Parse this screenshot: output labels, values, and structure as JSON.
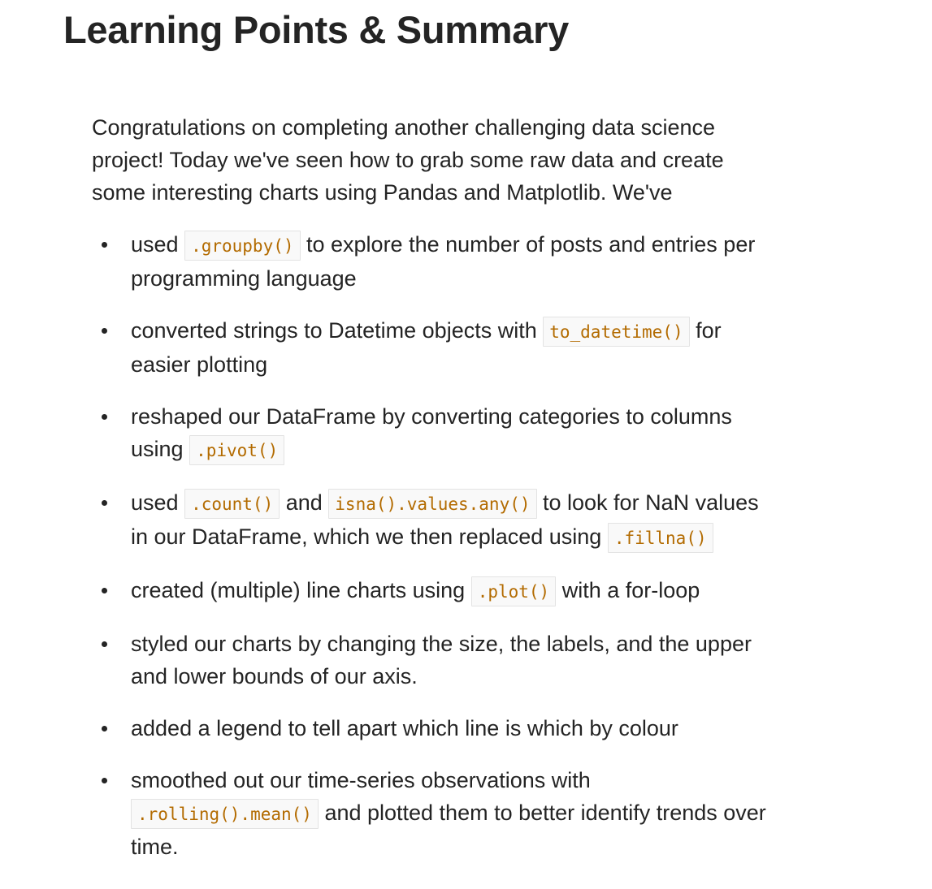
{
  "heading": "Learning Points & Summary",
  "intro": "Congratulations on completing another challenging data science project! Today we've seen how to grab some raw data and create some interesting charts using Pandas and Matplotlib. We've",
  "points": [
    {
      "t1": "used ",
      "c1": ".groupby()",
      "t2": " to explore the number of posts and entries per programming language"
    },
    {
      "t1": "converted strings to Datetime objects with ",
      "c1": "to_datetime()",
      "t2": " for easier plotting"
    },
    {
      "t1": "reshaped our DataFrame by converting categories to columns using ",
      "c1": ".pivot()"
    },
    {
      "t1": "used ",
      "c1": ".count()",
      "t2": " and ",
      "c2": "isna().values.any()",
      "t3": " to look for NaN values in our DataFrame, which we then replaced using ",
      "c3": ".fillna()"
    },
    {
      "t1": "created (multiple) line charts using ",
      "c1": ".plot()",
      "t2": " with a for-loop"
    },
    {
      "t1": "styled our charts by changing the size, the labels, and the upper and lower bounds of our axis."
    },
    {
      "t1": "added a legend to tell apart which line is which by colour"
    },
    {
      "t1": "smoothed out our time-series observations with ",
      "c1": ".rolling().mean()",
      "t2": " and plotted them to better identify trends over time."
    }
  ],
  "colors": {
    "text": "#242424",
    "code_text": "#b36b00",
    "code_bg": "#f9f9f9",
    "code_border": "#e3e3e3"
  }
}
